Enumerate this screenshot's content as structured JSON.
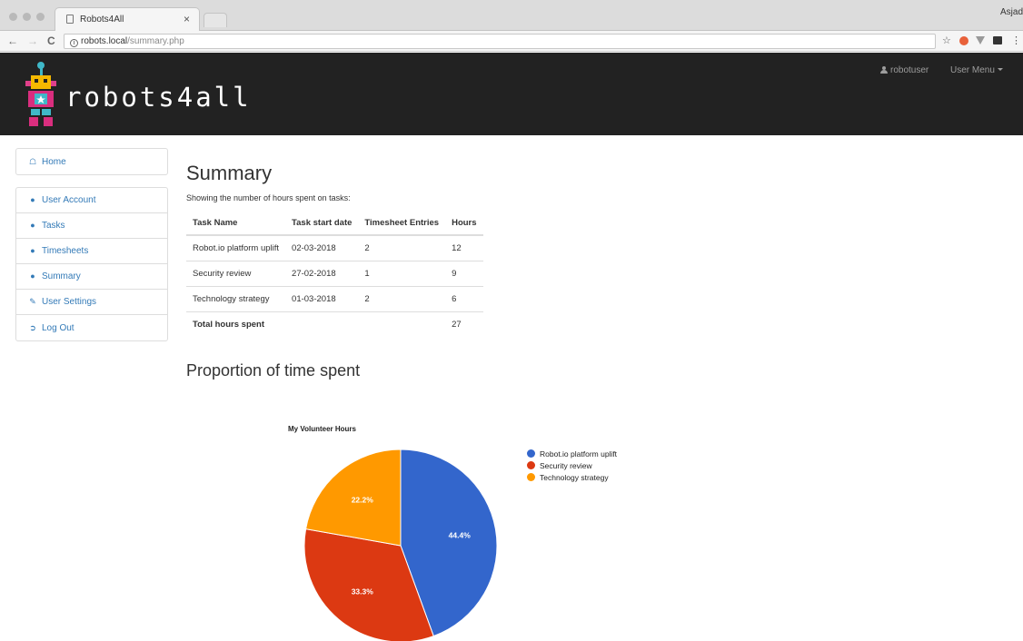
{
  "browser": {
    "tab_title": "Robots4All",
    "close_glyph": "×",
    "profile_name": "Asjad",
    "url_host": "robots.local",
    "url_path": "/summary.php",
    "back_glyph": "←",
    "forward_glyph": "→",
    "reload_glyph": "C",
    "info_glyph": "i",
    "star_glyph": "☆",
    "menu_glyph": "⋮"
  },
  "header": {
    "brand": "robots4all",
    "username": "robotuser",
    "user_menu": "User Menu"
  },
  "sidebar": {
    "home": {
      "label": "Home",
      "icon": "home-icon"
    },
    "items": [
      {
        "label": "User Account",
        "icon": "user-icon"
      },
      {
        "label": "Tasks",
        "icon": "user-icon"
      },
      {
        "label": "Timesheets",
        "icon": "user-icon"
      },
      {
        "label": "Summary",
        "icon": "user-icon"
      },
      {
        "label": "User Settings",
        "icon": "edit-icon"
      },
      {
        "label": "Log Out",
        "icon": "logout-icon"
      }
    ]
  },
  "main": {
    "title": "Summary",
    "intro": "Showing the number of hours spent on tasks:",
    "columns": [
      "Task Name",
      "Task start date",
      "Timesheet Entries",
      "Hours"
    ],
    "rows": [
      {
        "name": "Robot.io platform uplift",
        "start": "02-03-2018",
        "entries": "2",
        "hours": "12"
      },
      {
        "name": "Security review",
        "start": "27-02-2018",
        "entries": "1",
        "hours": "9"
      },
      {
        "name": "Technology strategy",
        "start": "01-03-2018",
        "entries": "2",
        "hours": "6"
      }
    ],
    "total_label": "Total hours spent",
    "total_hours": "27",
    "section_title": "Proportion of time spent"
  },
  "chart_data": {
    "type": "pie",
    "title": "My Volunteer Hours",
    "categories": [
      "Robot.io platform uplift",
      "Security review",
      "Technology strategy"
    ],
    "values": [
      12,
      9,
      6
    ],
    "labels": [
      "44.4%",
      "33.3%",
      "22.2%"
    ],
    "colors": [
      "#3366cc",
      "#dc3912",
      "#ff9900"
    ],
    "legend_position": "right"
  }
}
